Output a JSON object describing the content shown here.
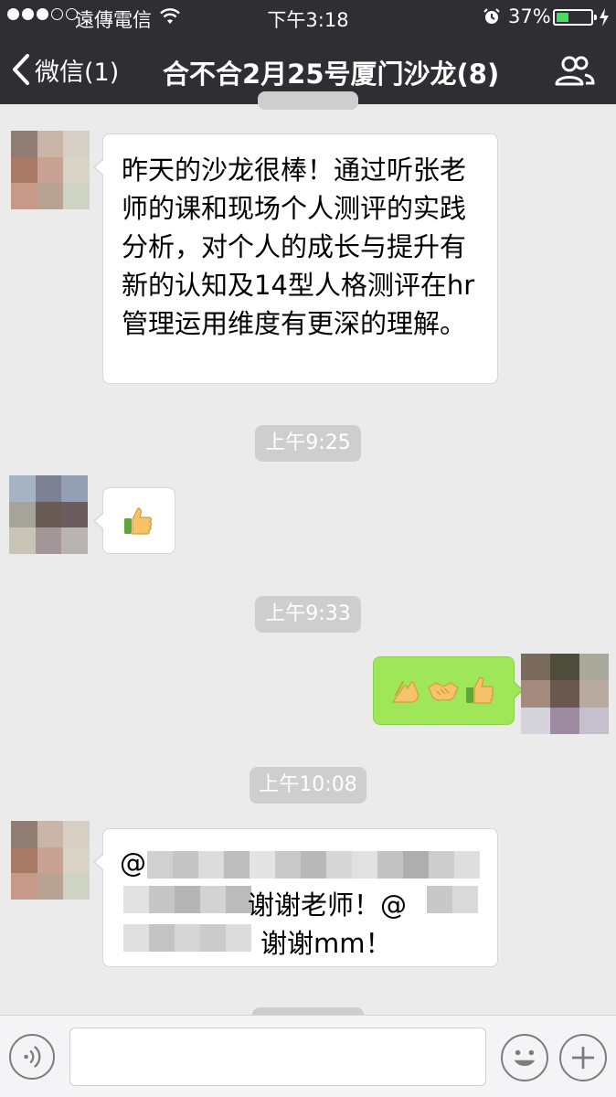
{
  "status_bar": {
    "carrier": "遠傳電信",
    "time": "下午3:18",
    "battery_percent_text": "37%",
    "battery_level": 0.37,
    "signal_bars_filled": 3,
    "signal_bars_total": 5
  },
  "nav": {
    "back_label": "微信(1)",
    "title": "合不合2月25号厦门沙龙(8)"
  },
  "messages": [
    {
      "side": "left",
      "type": "text",
      "text": "昨天的沙龙很棒！通过听张老师的课和现场个人测评的实践分析，对个人的成长与提升有新的认知及14型人格测评在hr管理运用维度有更深的理解。"
    },
    {
      "type": "timestamp",
      "text": "上午9:25"
    },
    {
      "side": "left",
      "type": "emoji",
      "emojis": [
        "thumbs-up"
      ]
    },
    {
      "type": "timestamp",
      "text": "上午9:33"
    },
    {
      "side": "right",
      "type": "emoji",
      "emojis": [
        "pointing-hand",
        "handshake",
        "thumbs-up"
      ]
    },
    {
      "type": "timestamp",
      "text": "上午10:08"
    },
    {
      "side": "left",
      "type": "text",
      "line1_prefix": "@",
      "line2_text": "谢谢老师！@",
      "line3_text": "谢谢mm！"
    }
  ],
  "colors": {
    "header_bg": "#2e2e33",
    "chat_bg": "#ebebeb",
    "my_bubble": "#9fe658",
    "battery_green": "#4cd964"
  }
}
